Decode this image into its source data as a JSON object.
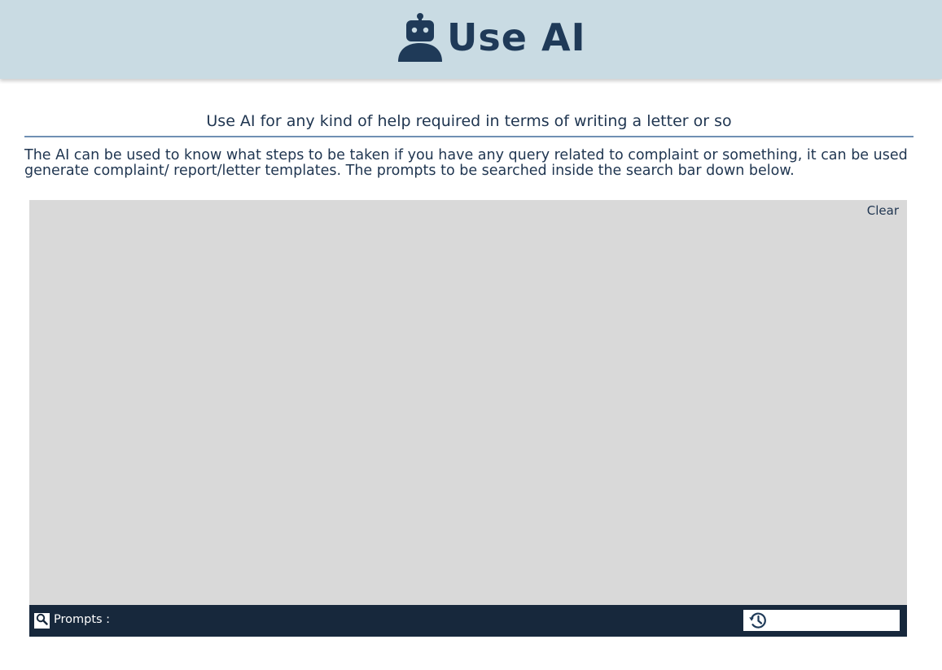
{
  "header": {
    "brand_text": "Use AI",
    "logo_icon": "robot-icon"
  },
  "intro": {
    "subtitle": "Use AI for any kind of help required in terms of writing a letter or so",
    "description": "The AI can be used to know what steps to be taken if you have any query related to complaint or something, it can be used generate complaint/ report/letter templates. The prompts to be searched inside the search bar down below."
  },
  "chat": {
    "clear_label": "Clear"
  },
  "prompt_bar": {
    "search_icon": "search-icon",
    "label": "Prompts :",
    "history_icon": "history-icon",
    "input_value": "",
    "input_placeholder": ""
  },
  "colors": {
    "header_bg": "#c9dbe3",
    "brand": "#1f3a58",
    "text": "#1f3550",
    "rule": "#6f8fb3",
    "chat_bg": "#d9d9d9",
    "prompt_bar_bg": "#17283c"
  }
}
